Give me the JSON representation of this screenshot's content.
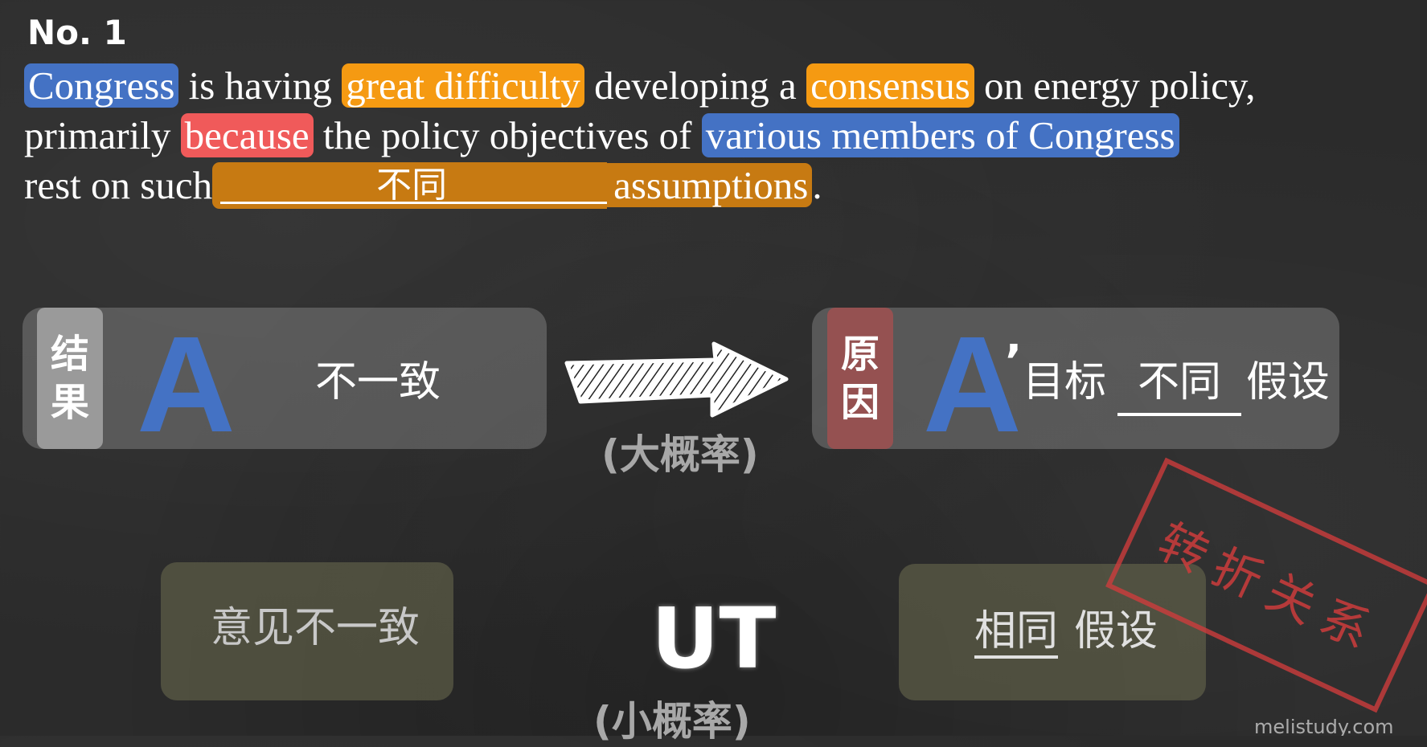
{
  "title": "No. 1",
  "sentence": {
    "w1": "Congress",
    "t1": " is having ",
    "w2": "great difficulty",
    "t2": " developing a ",
    "w3": "consensus",
    "t3": " on energy policy,",
    "t4": "primarily ",
    "w4": "because",
    "t5": " the policy objectives of ",
    "w5": "various members of Congress",
    "t6": "rest on such",
    "blank_fill": "不同",
    "w6": "assumptions",
    "t7": "."
  },
  "left_panel": {
    "tag": "结果",
    "letter": "A",
    "text": "不一致"
  },
  "arrow": {
    "caption": "(大概率)"
  },
  "right_panel": {
    "tag": "原因",
    "letter": "A",
    "prime": "’",
    "t1": "目标",
    "underlined": "不同",
    "t2": "假设"
  },
  "bottom_left": {
    "text": "意见不一致"
  },
  "center": {
    "text": "UT",
    "caption": "(小概率)"
  },
  "bottom_right": {
    "underlined": "相同",
    "text": "假设"
  },
  "stamp": {
    "text": "转折关系"
  },
  "watermark": "melistudy.com",
  "colors": {
    "blue": "#4472c4",
    "orange": "#f59a12",
    "red": "#f05a5a",
    "dark_orange": "#c77a12"
  }
}
